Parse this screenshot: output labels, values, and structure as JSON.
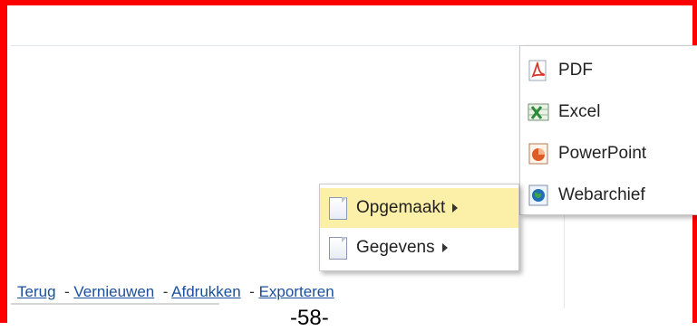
{
  "export_menu": {
    "items": [
      {
        "label": "PDF",
        "icon": "pdf-icon",
        "color": "#d9372b"
      },
      {
        "label": "Excel",
        "icon": "excel-icon",
        "color": "#2e8b3a"
      },
      {
        "label": "PowerPoint",
        "icon": "powerpoint-icon",
        "color": "#e05a24"
      },
      {
        "label": "Webarchief",
        "icon": "webarchive-icon",
        "color": "#1e6fb8"
      }
    ]
  },
  "format_menu": {
    "items": [
      {
        "label": "Opgemaakt",
        "icon": "document-icon",
        "highlighted": true,
        "has_submenu": true
      },
      {
        "label": "Gegevens",
        "icon": "document-icon",
        "highlighted": false,
        "has_submenu": true
      }
    ],
    "highlight_color": "#fcefa7"
  },
  "toolbar": {
    "back": "Terug",
    "refresh": "Vernieuwen",
    "print": "Afdrukken",
    "export": "Exporteren",
    "separator": "-"
  },
  "page_number": "-58-",
  "frame_color": "#ff0000"
}
